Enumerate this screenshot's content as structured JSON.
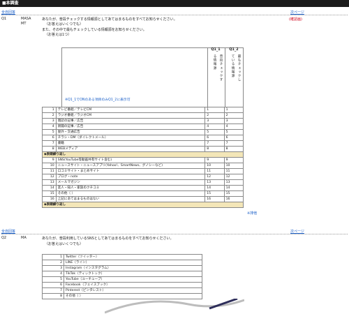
{
  "header": {
    "title": "■本調査"
  },
  "q1": {
    "link_left": "全自回答",
    "link_right": "次ページ",
    "id": "Q1",
    "type1": "MASA",
    "type2": "MT",
    "question": "あなたが、普段チェックする情報源としてあてはまるものをすべてお知らせください。",
    "note1": "（お答えはいくつでも）",
    "question2": "また、その中で最もチェックしている情報源をお知らせください。",
    "note2": "（お答えは1つ）",
    "required": "(確認画)",
    "col1_title": "Q1_1",
    "col1_body": "る情報源",
    "col1_sub": "普段チェックす",
    "col2_title": "Q1_2",
    "col2_sub": "最もチェックし",
    "col2_body": "ている情報源",
    "instruction": "※Q1_1でONのある項目のみQ1_2に表示可",
    "rows_a": [
      {
        "n": "1",
        "label": "テレビ番組／テレビCM",
        "c1": "1",
        "c2": "1"
      },
      {
        "n": "2",
        "label": "ラジオ番組／ラジオCM",
        "c1": "2",
        "c2": "2"
      },
      {
        "n": "3",
        "label": "雑誌の記事／広告",
        "c1": "3",
        "c2": "3"
      },
      {
        "n": "4",
        "label": "新聞の記事／広告",
        "c1": "4",
        "c2": "4"
      },
      {
        "n": "5",
        "label": "屋外・交通広告",
        "c1": "5",
        "c2": "5"
      },
      {
        "n": "6",
        "label": "チラシ・DM（ダイレクトメール）",
        "c1": "6",
        "c2": "6"
      },
      {
        "n": "7",
        "label": "書籍",
        "c1": "7",
        "c2": "7"
      },
      {
        "n": "8",
        "label": "WEBメディア",
        "c1": "8",
        "c2": "8"
      }
    ],
    "section_label": "◆表頭繰り返し",
    "rows_b": [
      {
        "n": "9",
        "label": "SNS(YouTube等動画共有サイト含む)",
        "c1": "9",
        "c2": "9"
      },
      {
        "n": "10",
        "label": "ニュースサイト・ニュースアプリ(Yahoo!、SmartNews、グノシーなど)",
        "c1": "10",
        "c2": "10"
      },
      {
        "n": "11",
        "label": "口コミサイト・まとめサイト",
        "c1": "11",
        "c2": "11"
      },
      {
        "n": "12",
        "label": "ブログ・note",
        "c1": "12",
        "c2": "12"
      },
      {
        "n": "13",
        "label": "メールマガジン",
        "c1": "13",
        "c2": "13"
      },
      {
        "n": "14",
        "label": "友人・知人・家族のクチコミ",
        "c1": "14",
        "c2": "14"
      },
      {
        "n": "15",
        "label": "その他（                                        ）",
        "c1": "15",
        "c2": "15"
      },
      {
        "n": "16",
        "label": "上記にあてはまるものはない",
        "c1": "16",
        "c2": "16"
      }
    ],
    "exclusive": "※排他",
    "section_label2": "◆表頭繰り返し"
  },
  "q2": {
    "link_left": "全自回答",
    "link_right": "次ページ",
    "id": "Q2",
    "type": "MA",
    "question": "あなたが、普段利用しているSNSとしてあてはまるものをすべてお知らせください。",
    "note": "（お答えはいくつでも）",
    "rows": [
      {
        "n": "1",
        "label": "Twitter（ツイッター）"
      },
      {
        "n": "2",
        "label": "LINE（ライン）"
      },
      {
        "n": "3",
        "label": "Instagram（インスタグラム）"
      },
      {
        "n": "4",
        "label": "TikTok（ティックトック）"
      },
      {
        "n": "5",
        "label": "YouTube（ユーチューブ）"
      },
      {
        "n": "6",
        "label": "Facebook（フェイスブック）"
      },
      {
        "n": "7",
        "label": "Pinterest（ピンタレスト）"
      },
      {
        "n": "8",
        "label": "その他（                                        ）"
      }
    ]
  }
}
